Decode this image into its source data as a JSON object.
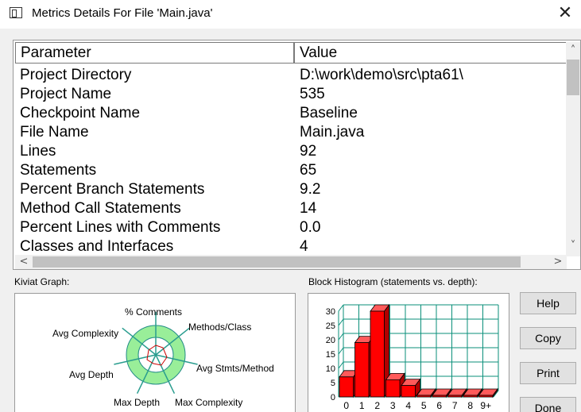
{
  "window": {
    "title": "Metrics Details For File 'Main.java'",
    "close_glyph": "✕"
  },
  "table": {
    "headers": {
      "parameter": "Parameter",
      "value": "Value"
    },
    "rows": [
      {
        "parameter": "Project Directory",
        "value": "D:\\work\\demo\\src\\pta61\\"
      },
      {
        "parameter": "Project Name",
        "value": "535"
      },
      {
        "parameter": "Checkpoint Name",
        "value": "Baseline"
      },
      {
        "parameter": "File Name",
        "value": "Main.java"
      },
      {
        "parameter": "Lines",
        "value": "92"
      },
      {
        "parameter": "Statements",
        "value": "65"
      },
      {
        "parameter": "Percent Branch Statements",
        "value": "9.2"
      },
      {
        "parameter": "Method Call Statements",
        "value": "14"
      },
      {
        "parameter": "Percent Lines with Comments",
        "value": "0.0"
      },
      {
        "parameter": "Classes and Interfaces",
        "value": "4"
      }
    ],
    "scroll": {
      "up": "˄",
      "down": "˅",
      "left": "<",
      "right": ">"
    }
  },
  "kiviat": {
    "label": "Kiviat Graph:",
    "axes": {
      "comments": "% Comments",
      "methods_class": "Methods/Class",
      "avg_stmts_method": "Avg Stmts/Method",
      "max_complexity": "Max Complexity",
      "max_depth": "Max Depth",
      "avg_depth": "Avg Depth",
      "avg_complexity": "Avg Complexity"
    },
    "colors": {
      "ring": "#99ee99",
      "outline": "#228b88",
      "spokes": "#2a9d8f",
      "line": "#cc0000"
    }
  },
  "histogram": {
    "label": "Block Histogram (statements vs. depth):",
    "chart_data": {
      "type": "bar",
      "categories": [
        "0",
        "1",
        "2",
        "3",
        "4",
        "5",
        "6",
        "7",
        "8",
        "9+"
      ],
      "values": [
        7,
        19,
        30,
        6,
        4,
        0,
        0,
        0,
        0,
        0
      ],
      "yticks": [
        "0",
        "5",
        "10",
        "15",
        "20",
        "25",
        "30"
      ],
      "ylim": [
        0,
        30
      ],
      "bar_color": "#ff0000",
      "grid_color": "#0a8f7a"
    }
  },
  "buttons": {
    "help": "Help",
    "copy": "Copy",
    "print": "Print",
    "done": "Done"
  }
}
